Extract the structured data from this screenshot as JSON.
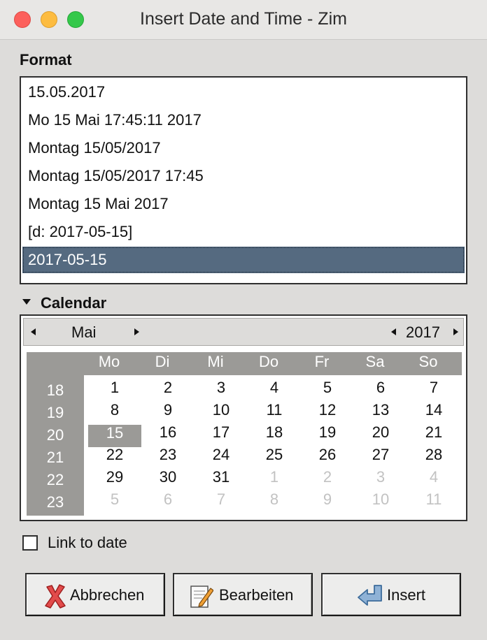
{
  "window": {
    "title": "Insert Date and Time - Zim"
  },
  "format": {
    "label": "Format",
    "items": [
      "15.05.2017",
      "Mo 15 Mai 17:45:11 2017",
      "Montag 15/05/2017",
      "Montag 15/05/2017 17:45",
      "Montag 15 Mai 2017",
      "[d: 2017-05-15]",
      "2017-05-15"
    ],
    "selected_index": 6
  },
  "calendar": {
    "label": "Calendar",
    "month": "Mai",
    "year": "2017",
    "weekdays": [
      "Mo",
      "Di",
      "Mi",
      "Do",
      "Fr",
      "Sa",
      "So"
    ],
    "weeks": [
      {
        "num": "18",
        "days": [
          "1",
          "2",
          "3",
          "4",
          "5",
          "6",
          "7"
        ]
      },
      {
        "num": "19",
        "days": [
          "8",
          "9",
          "10",
          "11",
          "12",
          "13",
          "14"
        ]
      },
      {
        "num": "20",
        "days": [
          "15",
          "16",
          "17",
          "18",
          "19",
          "20",
          "21"
        ]
      },
      {
        "num": "21",
        "days": [
          "22",
          "23",
          "24",
          "25",
          "26",
          "27",
          "28"
        ]
      },
      {
        "num": "22",
        "days": [
          "29",
          "30",
          "31",
          "1",
          "2",
          "3",
          "4"
        ]
      },
      {
        "num": "23",
        "days": [
          "5",
          "6",
          "7",
          "8",
          "9",
          "10",
          "11"
        ]
      }
    ],
    "selected_day": "15"
  },
  "link_to_date": {
    "label": "Link to date",
    "checked": false
  },
  "buttons": {
    "cancel": "Abbrechen",
    "edit": "Bearbeiten",
    "insert": "Insert"
  },
  "colors": {
    "selection": "#556a80",
    "calendar_gray": "#9b9a97"
  }
}
